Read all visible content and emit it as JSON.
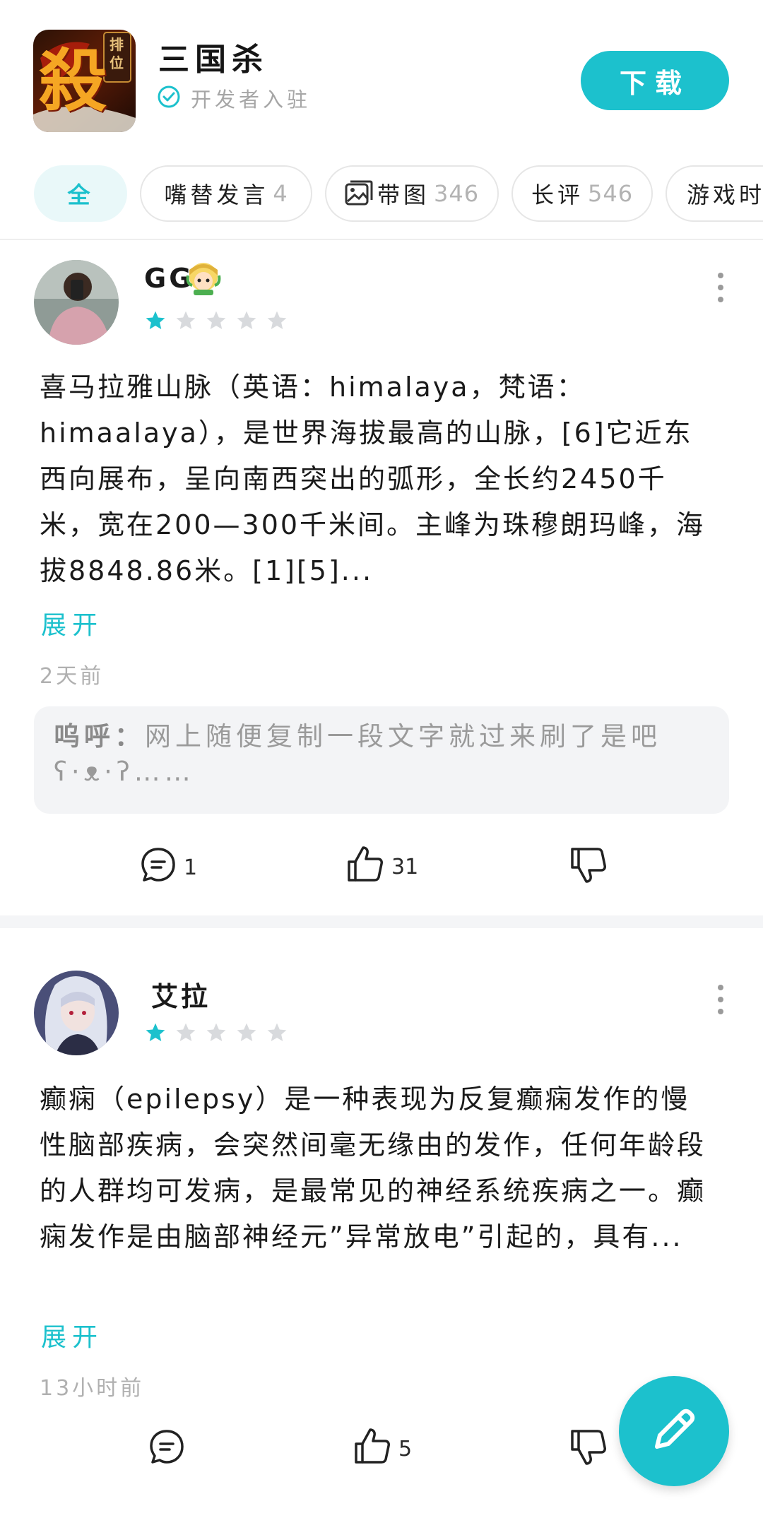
{
  "app": {
    "name": "三国杀",
    "developer_label": "开发者入驻",
    "download_label": "下载",
    "icon_badge": "排位",
    "icon_glyph": "殺"
  },
  "tabs": [
    {
      "label": "全",
      "count": ""
    },
    {
      "label": "嘴替发言",
      "count": "4"
    },
    {
      "label": "带图",
      "count": "346"
    },
    {
      "label": "长评",
      "count": "546"
    },
    {
      "label": "游戏时",
      "count": ""
    }
  ],
  "reviews": [
    {
      "username": "GG",
      "rating": 1,
      "body": "喜马拉雅山脉（英语：himalaya，梵语：himaalaya），是世界海拔最高的山脉，[6]它近东西向展布，呈向南西突出的弧形，全长约2450千米，宽在200—300千米间。主峰为珠穆朗玛峰，海拔8848.86米。[1][5]...",
      "expand_label": "展开",
      "time": "2天前",
      "reply": {
        "author": "呜呼",
        "separator": "：",
        "text": "网上随便复制一段文字就过来刷了是吧ʕ·ᴥ·ʔ……"
      },
      "comments": "1",
      "likes": "31"
    },
    {
      "username": "艾拉",
      "rating": 1,
      "body": "癫痫（epilepsy）是一种表现为反复癫痫发作的慢性脑部疾病，会突然间毫无缘由的发作，任何年龄段的人群均可发病，是最常见的神经系统疾病之一。癫痫发作是由脑部神经元”异常放电”引起的，具有...",
      "expand_label": "展开",
      "time": "13小时前",
      "comments": "",
      "likes": "5"
    }
  ],
  "colors": {
    "accent": "#1cc1cd",
    "star_empty": "#d8dadd",
    "muted_text": "#b0b0b0",
    "reply_bg": "#f3f4f6"
  },
  "icons": [
    "verified-check-icon",
    "image-icon",
    "more-vert-icon",
    "star-icon",
    "comment-icon",
    "thumbs-up-icon",
    "thumbs-down-icon",
    "edit-pencil-icon"
  ]
}
